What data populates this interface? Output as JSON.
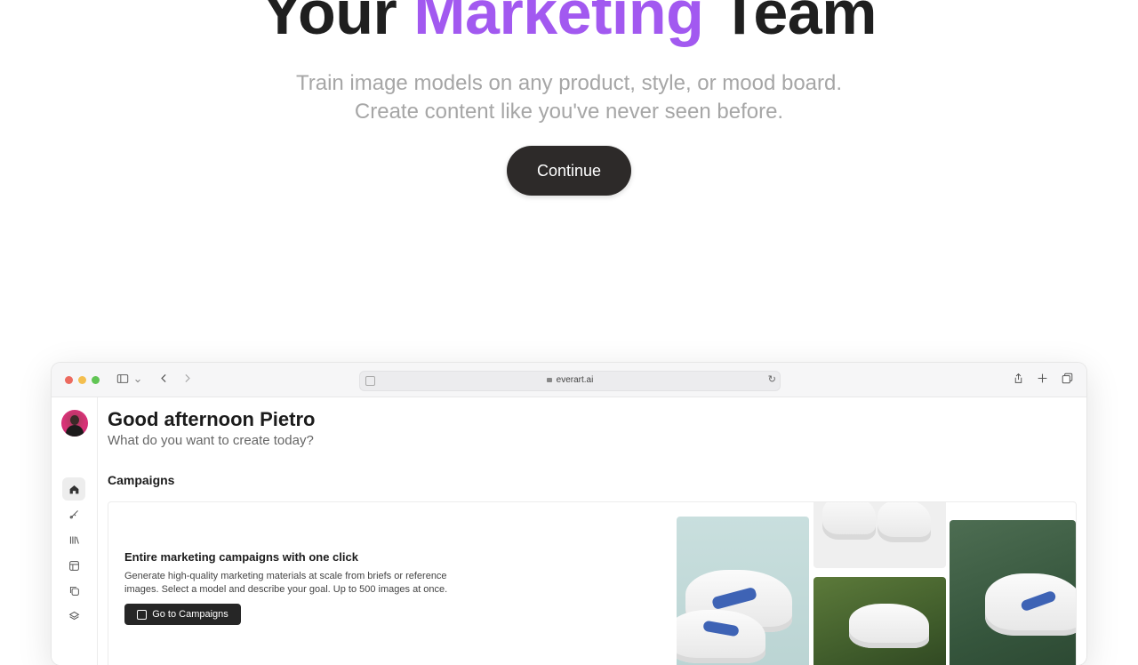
{
  "hero": {
    "title_pre": "Your",
    "title_accent": "Marketing",
    "title_post": "Team",
    "subtitle_line1": "Train image models on any product, style, or mood board.",
    "subtitle_line2": "Create content like you've never seen before.",
    "continue_label": "Continue",
    "accent_color": "#a259f0"
  },
  "browser": {
    "url": "everart.ai",
    "icons": [
      "sidebar-toggle-icon",
      "chevron-down-icon",
      "back-icon",
      "forward-icon",
      "reload-icon",
      "share-icon",
      "new-tab-icon",
      "tabs-overview-icon"
    ]
  },
  "sidebar": {
    "items": [
      {
        "icon": "home-icon",
        "active": true
      },
      {
        "icon": "brush-icon",
        "active": false
      },
      {
        "icon": "library-icon",
        "active": false
      },
      {
        "icon": "gallery-icon",
        "active": false
      },
      {
        "icon": "copy-icon",
        "active": false
      },
      {
        "icon": "layers-icon",
        "active": false
      }
    ]
  },
  "main": {
    "greeting": "Good afternoon Pietro",
    "greeting_sub": "What do you want to create today?",
    "section_title": "Campaigns",
    "card": {
      "title": "Entire marketing campaigns with one click",
      "desc_line1": "Generate high-quality marketing materials at scale from briefs or reference",
      "desc_line2": "images. Select a model and describe your goal. Up to 500 images at once.",
      "button_label": "Go to Campaigns"
    }
  }
}
